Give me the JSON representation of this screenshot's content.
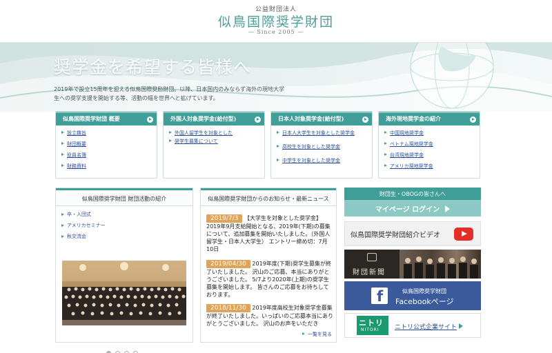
{
  "header": {
    "org_type": "公益財団法人",
    "org_name": "似鳥国際奨学財団",
    "since": "— Since 2005 —"
  },
  "hero": {
    "title": "奨学金を希望する皆様へ",
    "description": "2019年で設立15周年を迎える似鳥国際奨励財団。以降、日本国内のみならず海外の現地大学生への奨学支援を開始する等、活動の幅を世界へと拡げています。"
  },
  "categories": [
    {
      "title": "似鳥国際奨学財団 概要",
      "items": [
        "設立趣旨",
        "財団概要",
        "役員名簿",
        "財務資料"
      ]
    },
    {
      "title": "外国人対象奨学金(給付型)",
      "items": [
        "外国人留学生を対象とした",
        "奨学生募集について"
      ]
    },
    {
      "title": "日本人対象奨学金(給付型)",
      "items": [
        "日本人大学生を対象とした奨学金",
        "高校生を対象とした奨学金",
        "中学生を対象とした奨学金"
      ]
    },
    {
      "title": "海外現地奨学金の紹介",
      "items": [
        "中国現地奨学金",
        "ベトナム現地奨学金",
        "台湾現地奨学金",
        "アメリカ現地奨学金"
      ]
    }
  ],
  "activity": {
    "title": "似鳥国際奨学財団 財団活動の紹介",
    "items": [
      "卒・入団式",
      "アメリカセミナー",
      "秋交流会"
    ]
  },
  "news": {
    "title": "似鳥国際奨学財団からのお知らせ・最新ニュース",
    "items": [
      {
        "date": "2019/7/3",
        "text": "【大学生を対象とした奨学金】2019年9月支給開始となる、2019年(下期)の募集について、追加募集を開始いたしました。（外国人留学生・日本人大学生） エントリー締め切：7月10日"
      },
      {
        "date": "2019/04/30",
        "text": "2019年度(下期)奨学生募集が終了いたしました。 沢山のご応募、本当にありがとうございました。 5/7より2020年(上期)の奨学生募集を開始します。 皆さんのご応募をお待ちしております。"
      },
      {
        "date": "2018/11/30",
        "text": "2019年度高校生対象奨学金募集が終了いたしました。いっぱいのご応募本当にありがとうございました。 沢山のお声をいただき"
      }
    ],
    "more_label": "一覧を見る"
  },
  "sidebar": {
    "alumni_label": "財団生・OBOGの皆さんへ",
    "mypage_label": "マイページ ログイン",
    "video_label": "似鳥国際奨学財団紹介ビデオ",
    "newspaper_label": "財団新聞",
    "facebook_line1": "似鳥国際奨学財団",
    "facebook_line2": "Facebookページ",
    "nitori_logo_jp": "ニトリ",
    "nitori_logo_en": "NITORI",
    "nitori_label": "ニトリ公式企業サイト"
  },
  "carousel": {
    "total": 4,
    "active": 0
  },
  "colors": {
    "accent": "#3f9e98",
    "brand_text": "#4a9e9b",
    "date_badge": "#e0a458",
    "facebook": "#3b5a9c",
    "youtube": "#e52d27",
    "nitori": "#1c9a6f"
  },
  "icons": {
    "video": "youtube-play-icon",
    "facebook": "facebook-f-icon",
    "arrow": "chevron-right-icon"
  }
}
